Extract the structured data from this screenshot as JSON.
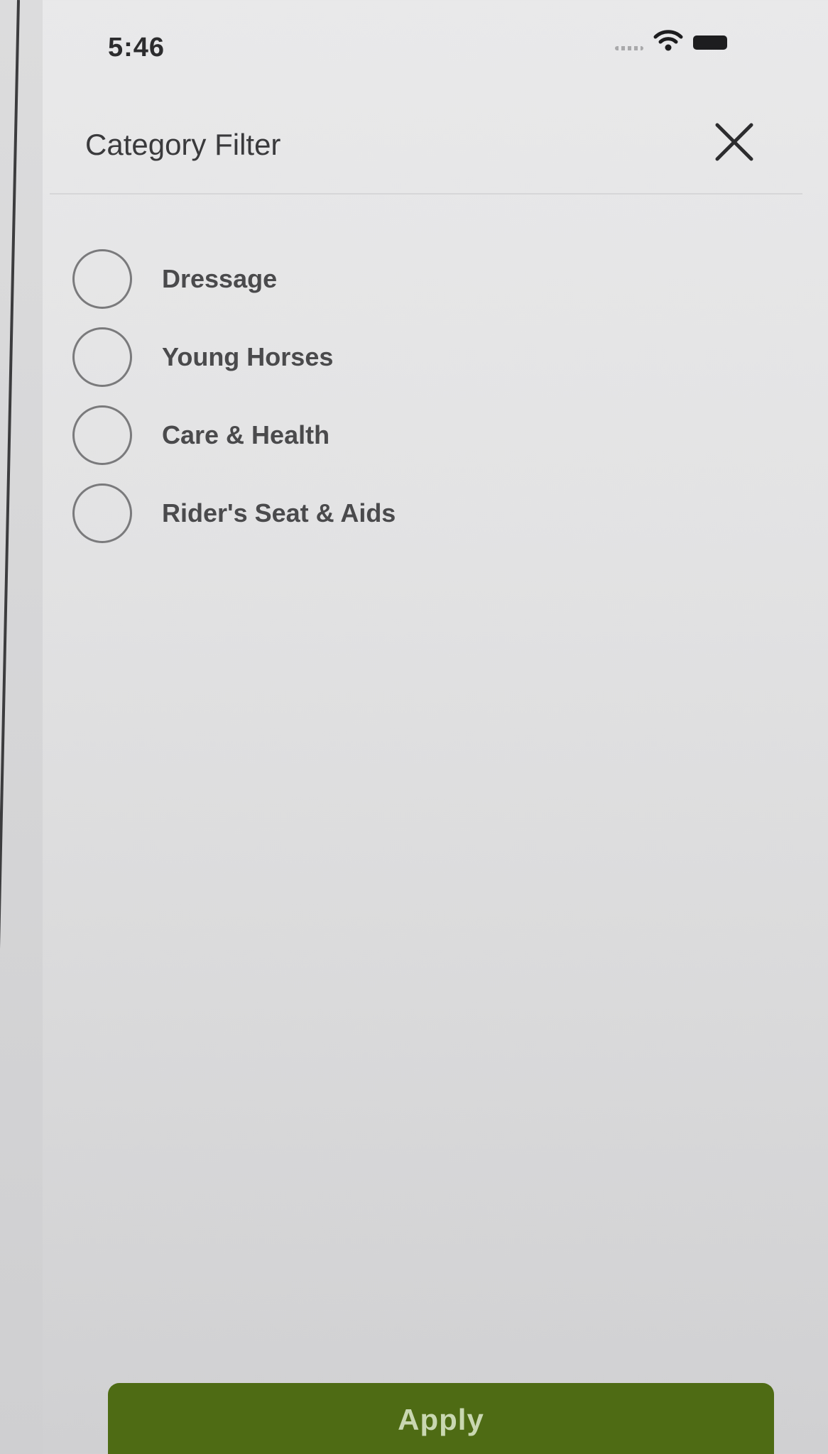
{
  "status_bar": {
    "time": "5:46",
    "icons": [
      "signal-dots-icon",
      "wifi-icon",
      "battery-icon"
    ]
  },
  "header": {
    "title": "Category Filter",
    "close_icon": "close-icon"
  },
  "options": [
    {
      "label": "Dressage",
      "selected": false
    },
    {
      "label": "Young Horses",
      "selected": false
    },
    {
      "label": "Care & Health",
      "selected": false
    },
    {
      "label": "Rider's Seat & Aids",
      "selected": false
    }
  ],
  "footer": {
    "apply_label": "Apply"
  },
  "colors": {
    "accent": "#4e6b14",
    "apply_text": "#c9d7b1"
  }
}
